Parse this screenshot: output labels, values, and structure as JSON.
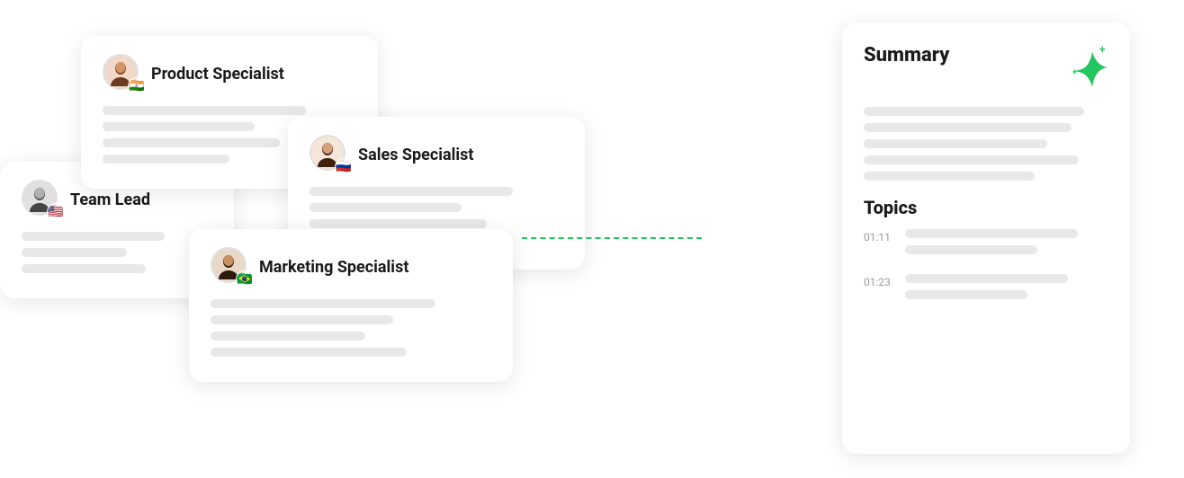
{
  "cards": {
    "product": {
      "title": "Product Specialist",
      "flag": "🇮🇳",
      "lines": [
        {
          "width": "80%"
        },
        {
          "width": "60%"
        },
        {
          "width": "70%"
        },
        {
          "width": "50%"
        }
      ]
    },
    "team": {
      "title": "Team Lead",
      "flag": "🇺🇸",
      "lines": [
        {
          "width": "75%"
        },
        {
          "width": "55%"
        },
        {
          "width": "65%"
        }
      ]
    },
    "sales": {
      "title": "Sales Specialist",
      "flag": "🇷🇺",
      "lines": [
        {
          "width": "80%"
        },
        {
          "width": "60%"
        },
        {
          "width": "70%"
        },
        {
          "width": "50%"
        }
      ]
    },
    "marketing": {
      "title": "Marketing Specialist",
      "flag": "🇧🇷",
      "lines": [
        {
          "width": "80%"
        },
        {
          "width": "65%"
        },
        {
          "width": "55%"
        },
        {
          "width": "70%"
        }
      ]
    }
  },
  "summary": {
    "title": "Summary",
    "summary_lines": [
      {
        "width": "90%"
      },
      {
        "width": "85%"
      },
      {
        "width": "75%"
      },
      {
        "width": "88%"
      },
      {
        "width": "70%"
      }
    ],
    "topics_title": "Topics",
    "topics": [
      {
        "time": "01:11",
        "lines": [
          {
            "width": "85%"
          },
          {
            "width": "65%"
          }
        ]
      },
      {
        "time": "01:23",
        "lines": [
          {
            "width": "80%"
          },
          {
            "width": "60%"
          }
        ]
      }
    ]
  }
}
